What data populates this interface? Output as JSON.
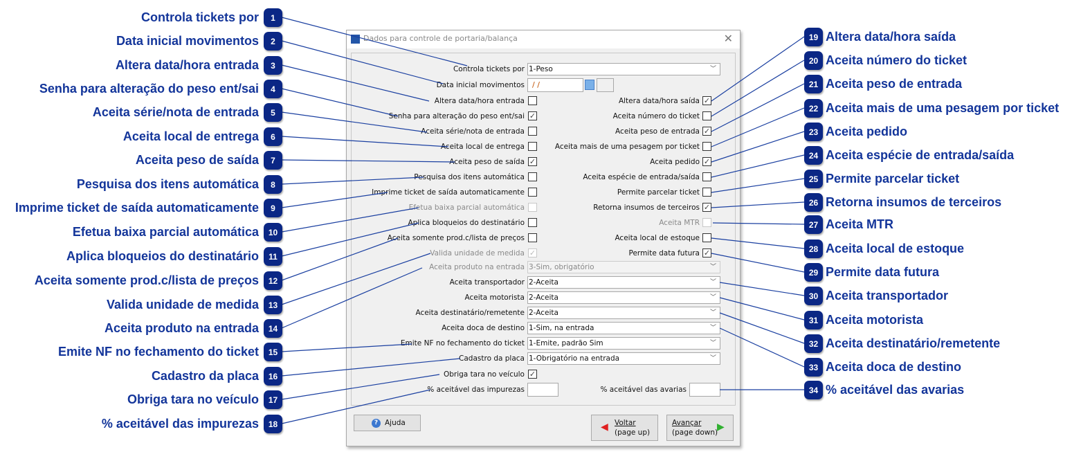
{
  "dialog": {
    "title": "Dados para controle de portaria/balança",
    "close_icon": "close-icon"
  },
  "fields": {
    "controla_tickets": {
      "label": "Controla tickets por",
      "value": "1-Peso"
    },
    "data_inicial": {
      "label": "Data inicial movimentos",
      "value": " /  /"
    },
    "left_checks": [
      {
        "label": "Altera data/hora entrada",
        "checked": false,
        "disabled": false
      },
      {
        "label": "Senha para alteração do peso ent/sai",
        "checked": true,
        "disabled": false
      },
      {
        "label": "Aceita série/nota de entrada",
        "checked": false,
        "disabled": false
      },
      {
        "label": "Aceita local de entrega",
        "checked": false,
        "disabled": false
      },
      {
        "label": "Aceita peso de saída",
        "checked": true,
        "disabled": false
      },
      {
        "label": "Pesquisa dos itens automática",
        "checked": false,
        "disabled": false
      },
      {
        "label": "Imprime ticket de saída automaticamente",
        "checked": false,
        "disabled": false
      },
      {
        "label": "Efetua baixa parcial automática",
        "checked": false,
        "disabled": true
      },
      {
        "label": "Aplica bloqueios do destinatário",
        "checked": false,
        "disabled": false
      },
      {
        "label": "Aceita somente prod.c/lista de preços",
        "checked": false,
        "disabled": false
      },
      {
        "label": "Valida unidade de medida",
        "checked": true,
        "disabled": true
      }
    ],
    "right_checks": [
      {
        "label": "Altera data/hora saída",
        "checked": true,
        "disabled": false
      },
      {
        "label": "Aceita número do ticket",
        "checked": false,
        "disabled": false
      },
      {
        "label": "Aceita peso de entrada",
        "checked": true,
        "disabled": false
      },
      {
        "label": "Aceita mais de uma pesagem por ticket",
        "checked": false,
        "disabled": false
      },
      {
        "label": "Aceita pedido",
        "checked": true,
        "disabled": false
      },
      {
        "label": "Aceita espécie de entrada/saída",
        "checked": false,
        "disabled": false
      },
      {
        "label": "Permite parcelar ticket",
        "checked": false,
        "disabled": false
      },
      {
        "label": "Retorna insumos de terceiros",
        "checked": true,
        "disabled": false
      },
      {
        "label": "Aceita MTR",
        "checked": false,
        "disabled": true
      },
      {
        "label": "Aceita local de estoque",
        "checked": false,
        "disabled": false
      },
      {
        "label": "Permite data futura",
        "checked": true,
        "disabled": false
      }
    ],
    "combos": [
      {
        "label": "Aceita produto na entrada",
        "value": "3-Sim, obrigatório",
        "disabled": true
      },
      {
        "label": "Aceita transportador",
        "value": "2-Aceita",
        "disabled": false
      },
      {
        "label": "Aceita motorista",
        "value": "2-Aceita",
        "disabled": false
      },
      {
        "label": "Aceita destinatário/remetente",
        "value": "2-Aceita",
        "disabled": false
      },
      {
        "label": "Aceita doca de destino",
        "value": "1-Sim, na entrada",
        "disabled": false
      },
      {
        "label": "Emite NF no fechamento do ticket",
        "value": "1-Emite, padrão Sim",
        "disabled": false
      },
      {
        "label": "Cadastro da placa",
        "value": "1-Obrigatório na entrada",
        "disabled": false
      }
    ],
    "obriga_tara": {
      "label": "Obriga tara no veículo",
      "checked": true
    },
    "impurezas": {
      "label": "% aceitável das impurezas",
      "value": ""
    },
    "avarias": {
      "label": "% aceitável das avarias",
      "value": ""
    }
  },
  "buttons": {
    "help": "Ajuda",
    "back_line1": "Voltar",
    "back_line2": "(page up)",
    "next_line1": "Avançar",
    "next_line2": "(page down)"
  },
  "callouts_left": [
    {
      "n": "1",
      "text": "Controla tickets por"
    },
    {
      "n": "2",
      "text": "Data inicial movimentos"
    },
    {
      "n": "3",
      "text": "Altera data/hora entrada"
    },
    {
      "n": "4",
      "text": "Senha para alteração do peso ent/sai"
    },
    {
      "n": "5",
      "text": "Aceita série/nota de entrada"
    },
    {
      "n": "6",
      "text": "Aceita local de entrega"
    },
    {
      "n": "7",
      "text": "Aceita peso de saída"
    },
    {
      "n": "8",
      "text": "Pesquisa dos itens automática"
    },
    {
      "n": "9",
      "text": "Imprime ticket de saída automaticamente"
    },
    {
      "n": "10",
      "text": "Efetua baixa parcial automática"
    },
    {
      "n": "11",
      "text": "Aplica bloqueios do destinatário"
    },
    {
      "n": "12",
      "text": "Aceita somente prod.c/lista de preços"
    },
    {
      "n": "13",
      "text": "Valida unidade de medida"
    },
    {
      "n": "14",
      "text": "Aceita produto na entrada"
    },
    {
      "n": "15",
      "text": "Emite NF no fechamento do ticket"
    },
    {
      "n": "16",
      "text": "Cadastro da placa"
    },
    {
      "n": "17",
      "text": "Obriga tara no veículo"
    },
    {
      "n": "18",
      "text": "% aceitável das impurezas"
    }
  ],
  "callouts_right": [
    {
      "n": "19",
      "text": "Altera data/hora saída"
    },
    {
      "n": "20",
      "text": "Aceita número do ticket"
    },
    {
      "n": "21",
      "text": "Aceita peso de entrada"
    },
    {
      "n": "22",
      "text": "Aceita mais de uma pesagem por ticket"
    },
    {
      "n": "23",
      "text": "Aceita pedido"
    },
    {
      "n": "24",
      "text": "Aceita espécie de entrada/saída"
    },
    {
      "n": "25",
      "text": "Permite parcelar ticket"
    },
    {
      "n": "26",
      "text": "Retorna insumos de terceiros"
    },
    {
      "n": "27",
      "text": "Aceita MTR"
    },
    {
      "n": "28",
      "text": "Aceita local de estoque"
    },
    {
      "n": "29",
      "text": "Permite data futura"
    },
    {
      "n": "30",
      "text": "Aceita transportador"
    },
    {
      "n": "31",
      "text": "Aceita motorista"
    },
    {
      "n": "32",
      "text": "Aceita destinatário/remetente"
    },
    {
      "n": "33",
      "text": "Aceita doca de destino"
    },
    {
      "n": "34",
      "text": "% aceitável das avarias"
    }
  ],
  "colors": {
    "callout_text": "#13359a",
    "badge": "#0b2785",
    "leader_line": "#1a3fa0"
  }
}
